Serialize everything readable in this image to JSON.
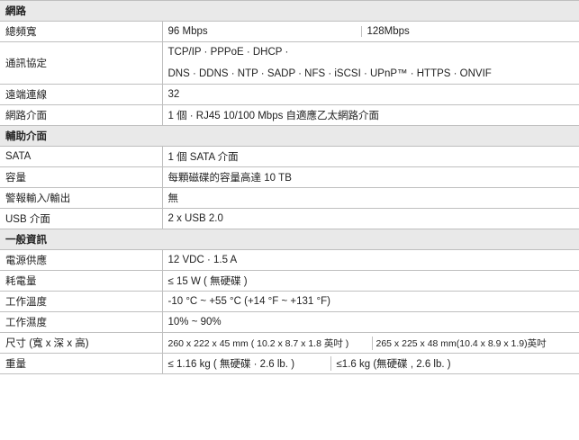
{
  "sections": {
    "network": "網路",
    "aux": "輔助介面",
    "general": "一般資訊"
  },
  "rows": {
    "bandwidth": {
      "label": "總頻寬",
      "v1": "96 Mbps",
      "v2": "128Mbps"
    },
    "protocol": {
      "label": "通訊協定",
      "line1": "TCP/IP · PPPoE · DHCP ·",
      "line2": "DNS · DDNS · NTP · SADP · NFS · iSCSI · UPnP™ ·   HTTPS · ONVIF"
    },
    "remote": {
      "label": "遠端連線",
      "value": "32"
    },
    "netif": {
      "label": "網路介面",
      "value": "1 個 · RJ45 10/100 Mbps 自適應乙太網路介面"
    },
    "sata": {
      "label": "SATA",
      "value": "1 個 SATA 介面"
    },
    "capacity": {
      "label": "容量",
      "value": "每顆磁碟的容量高達 10 TB"
    },
    "alarm": {
      "label": "警報輸入/輸出",
      "value": "無"
    },
    "usb": {
      "label": "USB 介面",
      "value": "2 x USB 2.0"
    },
    "power": {
      "label": "電源供應",
      "value": "12 VDC · 1.5 A"
    },
    "consumption": {
      "label": "耗電量",
      "value": "≤ 15 W ( 無硬碟 )"
    },
    "temp": {
      "label": "工作溫度",
      "value": "-10 °C ~ +55 °C (+14 °F ~ +131 °F)"
    },
    "humidity": {
      "label": "工作濕度",
      "value": "10% ~ 90%"
    },
    "size": {
      "label": "尺寸 (寬 x 深 x 高)",
      "v1": "260 x 222 x 45 mm ( 10.2 x 8.7 x 1.8 英吋 )",
      "v2": "265 x 225 x 48 mm(10.4 x 8.9 x 1.9)英吋"
    },
    "weight": {
      "label": "重量",
      "v1": "≤ 1.16 kg ( 無硬碟 · 2.6 lb. )",
      "v2": "≤1.6 kg (無硬碟 ,  2.6 lb. )"
    }
  }
}
